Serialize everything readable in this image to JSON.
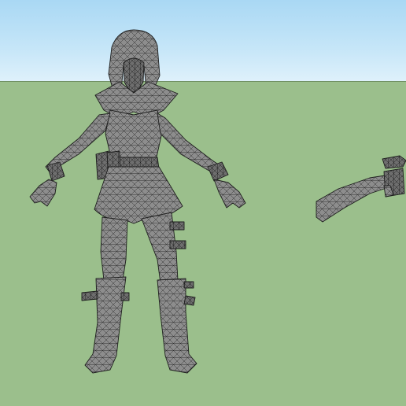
{
  "scene": {
    "sky_color": "#b9e0f6",
    "ground_color": "#9bbf8c",
    "model_fill": "#8a8a8a",
    "wire_color": "#1e1e1e"
  },
  "objects": [
    {
      "name": "character-model",
      "icon": "wireframe-figure"
    },
    {
      "name": "rifle-model",
      "icon": "wireframe-rifle"
    }
  ]
}
